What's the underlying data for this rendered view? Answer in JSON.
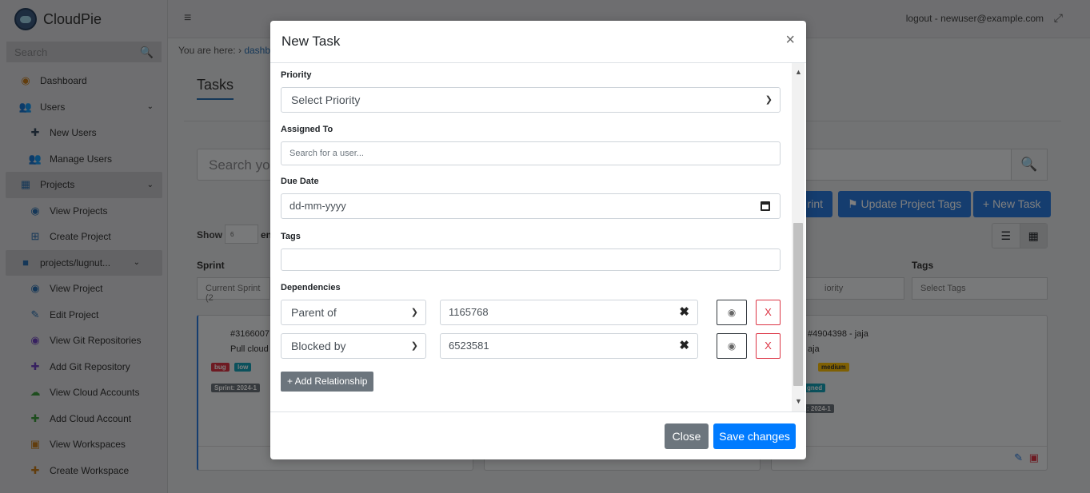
{
  "app": {
    "name": "CloudPie"
  },
  "sidebar": {
    "search_placeholder": "Search",
    "items": [
      {
        "label": "Dashboard"
      },
      {
        "label": "Users"
      },
      {
        "label": "New Users"
      },
      {
        "label": "Manage Users"
      },
      {
        "label": "Projects"
      },
      {
        "label": "View Projects"
      },
      {
        "label": "Create Project"
      },
      {
        "label": "projects/lugnut..."
      },
      {
        "label": "View Project"
      },
      {
        "label": "Edit Project"
      },
      {
        "label": "View Git Repositories"
      },
      {
        "label": "Add Git Repository"
      },
      {
        "label": "View Cloud Accounts"
      },
      {
        "label": "Add Cloud Account"
      },
      {
        "label": "View Workspaces"
      },
      {
        "label": "Create Workspace"
      }
    ]
  },
  "topbar": {
    "logout_text": "logout - newuser@example.com"
  },
  "breadcrumb": {
    "prefix": "You are here:",
    "sep": "›",
    "link": "dashb"
  },
  "page": {
    "title": "Tasks",
    "search_placeholder": "Search you",
    "btn_sprint": "rint",
    "btn_update_tags": "Update Project Tags",
    "btn_new_task": "+ New Task",
    "show_label": "Show",
    "show_value": "6",
    "show_suffix": "en",
    "sprint_label": "Sprint",
    "tags_label": "Tags",
    "sprint_filter": "Current Sprint (2",
    "priority_filter_tail": "iority",
    "tags_filter": "Select Tags"
  },
  "cards": [
    {
      "id": "#3166007",
      "title": "Pull cloud",
      "badge1": "bug",
      "badge2": "low",
      "sprint": "Sprint: 2024-1"
    },
    {
      "id": "#4904398 - jaja",
      "title": "aja",
      "badge2": "medium",
      "status_tail": "gned",
      "sprint_tail": ": 2024-1"
    }
  ],
  "modal": {
    "title": "New Task",
    "close_symbol": "×",
    "priority": {
      "label": "Priority",
      "value": "Select Priority"
    },
    "assigned": {
      "label": "Assigned To",
      "placeholder": "Search for a user..."
    },
    "due": {
      "label": "Due Date",
      "value": "dd-mm-yyyy"
    },
    "tags": {
      "label": "Tags",
      "value": ""
    },
    "dependencies": {
      "label": "Dependencies",
      "rows": [
        {
          "type": "Parent of",
          "value": "1165768",
          "remove": "X"
        },
        {
          "type": "Blocked by",
          "value": "6523581",
          "remove": "X"
        }
      ]
    },
    "add_relationship": "+ Add Relationship",
    "btn_close": "Close",
    "btn_save": "Save changes"
  },
  "colors": {
    "primary": "#007bff",
    "secondary": "#6c757d",
    "danger": "#dc3545"
  }
}
